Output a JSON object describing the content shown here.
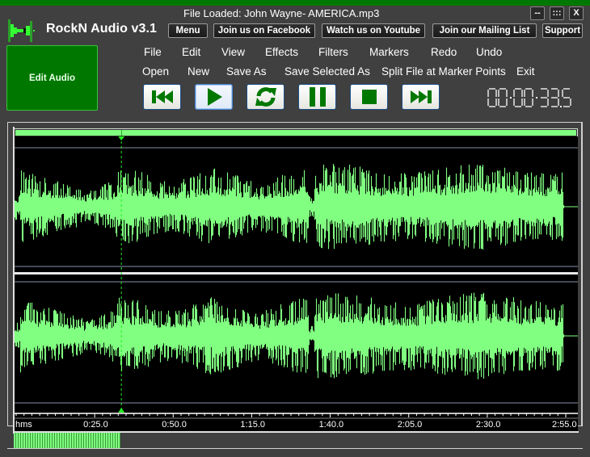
{
  "app": {
    "title": "RockN Audio v3.1",
    "file_loaded": "File Loaded: John Wayne- AMERICA.mp3",
    "accent_color": "#007800",
    "wave_color": "#80ff80"
  },
  "window_controls": {
    "minimize": "--",
    "maximize": ":::",
    "close": "X"
  },
  "top_buttons": [
    {
      "label": "Menu"
    },
    {
      "label": "Join us on Facebook"
    },
    {
      "label": "Watch us on Youtube"
    },
    {
      "label": "Join our Mailing List"
    },
    {
      "label": "Support"
    }
  ],
  "edit_audio_label": "Edit Audio",
  "menu_row1": [
    "File",
    "Edit",
    "View",
    "Effects",
    "Filters",
    "Markers",
    "Redo",
    "Undo"
  ],
  "menu_row2": [
    "Open",
    "New",
    "Save As",
    "Save Selected As",
    "Split File at Marker Points",
    "Exit"
  ],
  "transport": [
    {
      "name": "rewind-to-start",
      "icon": "skip-back-icon",
      "active": false
    },
    {
      "name": "play",
      "icon": "play-icon",
      "active": true
    },
    {
      "name": "loop",
      "icon": "loop-icon",
      "active": false
    },
    {
      "name": "pause",
      "icon": "pause-icon",
      "active": false
    },
    {
      "name": "stop",
      "icon": "stop-icon",
      "active": false
    },
    {
      "name": "skip-to-end",
      "icon": "skip-forward-icon",
      "active": false
    }
  ],
  "timer": "00:00:33.5",
  "waveform": {
    "channels": 2,
    "duration_seconds": 177,
    "playhead_seconds": 33.5,
    "ruler_unit": "hms",
    "ruler_labels": [
      "0:25.0",
      "0:50.0",
      "1:15.0",
      "1:40.0",
      "2:05.0",
      "2:30.0",
      "2:55.0"
    ],
    "ruler_label_seconds": [
      25,
      50,
      75,
      100,
      125,
      150,
      175
    ],
    "scroll_progress_percent": 19
  }
}
